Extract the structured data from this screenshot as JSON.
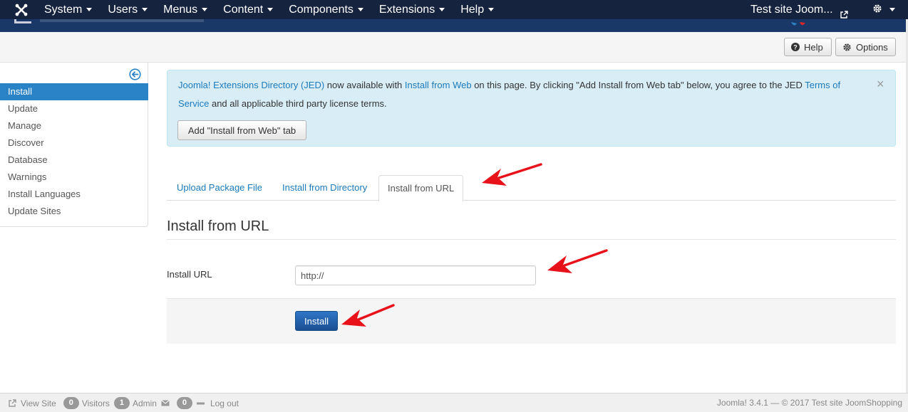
{
  "navbar": {
    "menus": [
      {
        "label": "System"
      },
      {
        "label": "Users"
      },
      {
        "label": "Menus"
      },
      {
        "label": "Content"
      },
      {
        "label": "Components"
      },
      {
        "label": "Extensions"
      },
      {
        "label": "Help"
      }
    ],
    "site_link": "Test site Joom...",
    "icons": {
      "logo": "joomla-logo-icon",
      "external": "external-link-icon",
      "settings": "gear-icon"
    }
  },
  "toolbar": {
    "help_label": "Help",
    "options_label": "Options"
  },
  "sidebar": {
    "items": [
      {
        "label": "Install",
        "active": true
      },
      {
        "label": "Update"
      },
      {
        "label": "Manage"
      },
      {
        "label": "Discover"
      },
      {
        "label": "Database"
      },
      {
        "label": "Warnings"
      },
      {
        "label": "Install Languages"
      },
      {
        "label": "Update Sites"
      }
    ]
  },
  "alert": {
    "jed_link": "Joomla! Extensions Directory (JED)",
    "text1": " now available with ",
    "install_web_link": "Install from Web",
    "text2": " on this page.  By clicking \"Add Install from Web tab\" below, you agree to the JED ",
    "tos_link": "Terms of Service",
    "text3": " and all applicable third party license terms.",
    "close": "×",
    "button_label": "Add \"Install from Web\" tab"
  },
  "tabs": [
    {
      "label": "Upload Package File"
    },
    {
      "label": "Install from Directory"
    },
    {
      "label": "Install from URL",
      "active": true
    }
  ],
  "form": {
    "legend": "Install from URL",
    "url_label": "Install URL",
    "url_value": "http://",
    "install_label": "Install"
  },
  "footer": {
    "view_site": "View Site",
    "visitors_count": "0",
    "visitors_label": "Visitors",
    "admin_count": "1",
    "admin_label": "Admin",
    "messages_count": "0",
    "logout": "Log out",
    "right_text": "Joomla! 3.4.1  —  © 2017 Test site JoomShopping"
  },
  "colors": {
    "navbar": "#16233f",
    "header": "#1a3867",
    "active": "#2a83c6",
    "link": "#1b7bbd",
    "alert_bg": "#d9edf7",
    "arrow": "#e8121b"
  }
}
